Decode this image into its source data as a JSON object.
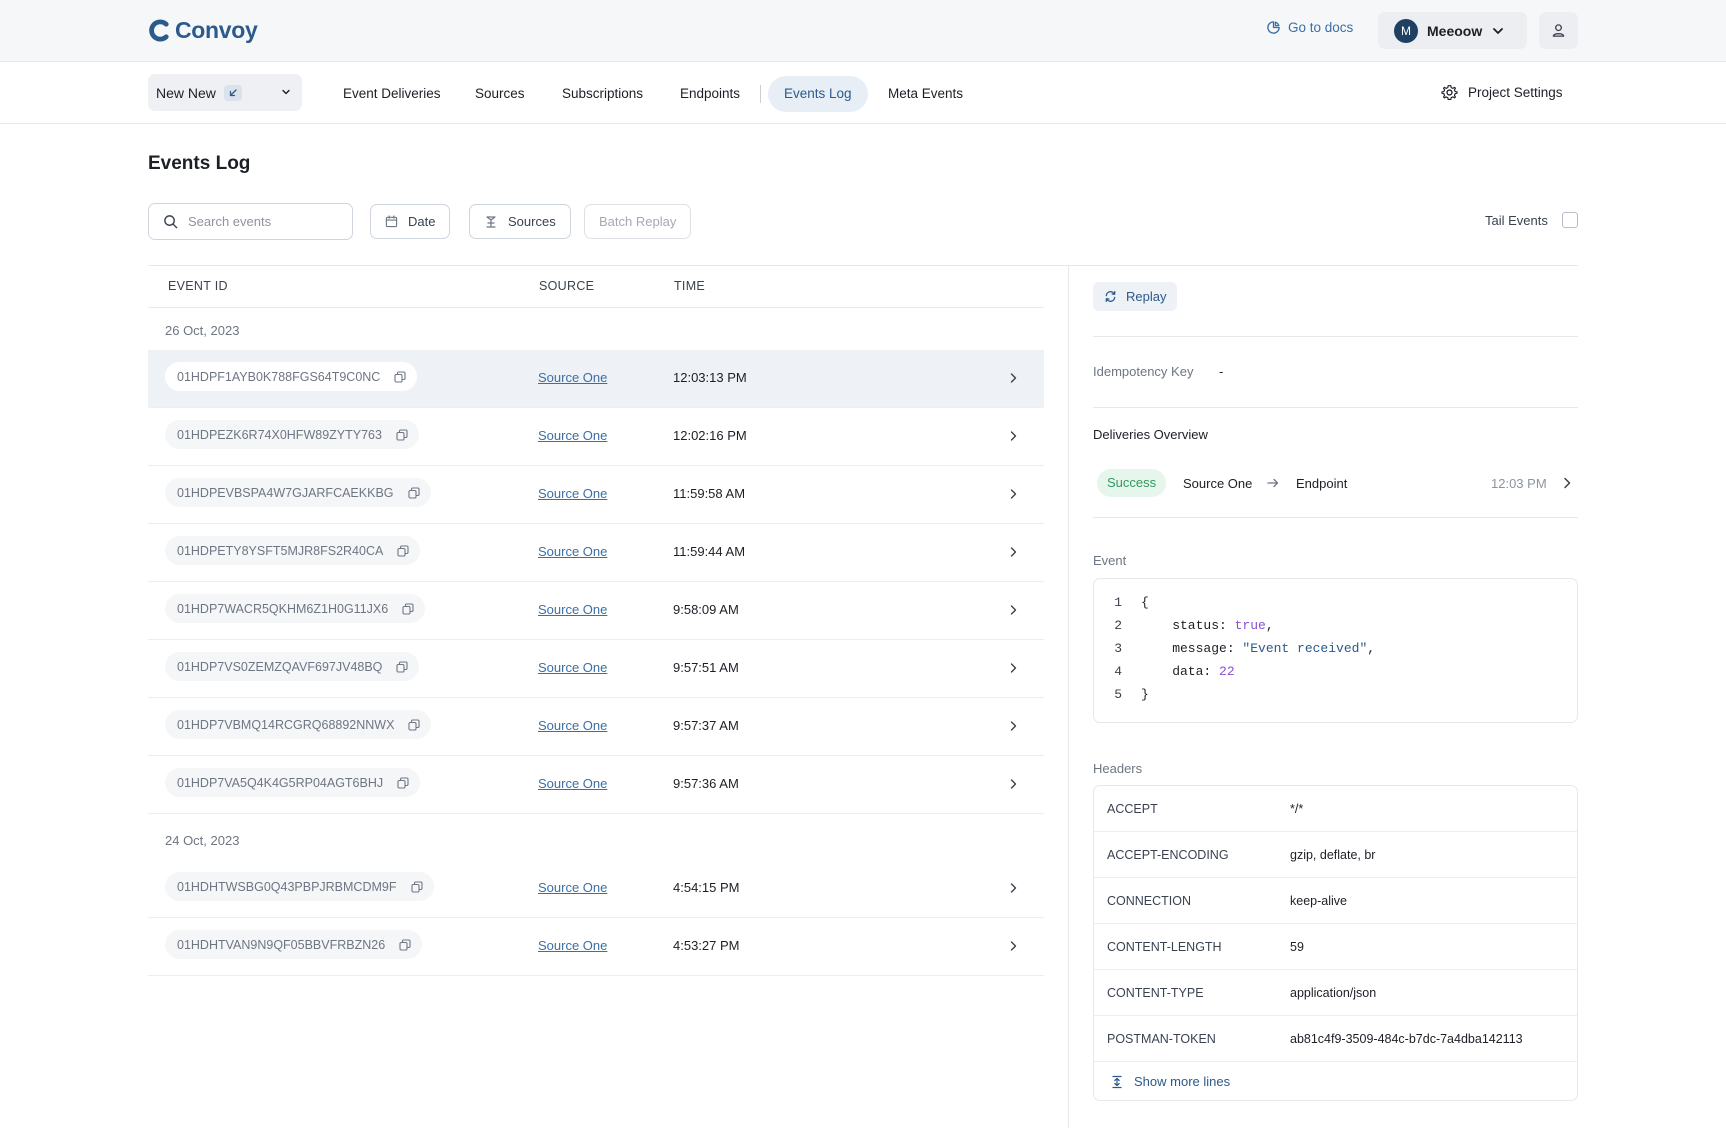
{
  "brand": {
    "name": "Convoy"
  },
  "topbar": {
    "docs_label": "Go to docs",
    "org_initial": "M",
    "org_name": "Meeoow"
  },
  "nav": {
    "project_name": "New New",
    "items": [
      {
        "label": "Event Deliveries"
      },
      {
        "label": "Sources"
      },
      {
        "label": "Subscriptions"
      },
      {
        "label": "Endpoints"
      },
      {
        "label": "Events Log"
      },
      {
        "label": "Meta Events"
      }
    ],
    "active_item": "Events Log",
    "settings_label": "Project Settings"
  },
  "page": {
    "title": "Events Log",
    "search_placeholder": "Search events",
    "date_label": "Date",
    "sources_label": "Sources",
    "batch_replay_label": "Batch Replay",
    "tail_label": "Tail Events",
    "tail_checked": false
  },
  "table": {
    "columns": [
      "EVENT ID",
      "SOURCE",
      "TIME"
    ],
    "groups": [
      {
        "date": "26 Oct, 2023",
        "rows": [
          {
            "id": "01HDPF1AYB0K788FGS64T9C0NC",
            "source": "Source One",
            "time": "12:03:13 PM",
            "selected": true
          },
          {
            "id": "01HDPEZK6R74X0HFW89ZYTY763",
            "source": "Source One",
            "time": "12:02:16 PM"
          },
          {
            "id": "01HDPEVBSPA4W7GJARFCAEKKBG",
            "source": "Source One",
            "time": "11:59:58 AM"
          },
          {
            "id": "01HDPETY8YSFT5MJR8FS2R40CA",
            "source": "Source One",
            "time": "11:59:44 AM"
          },
          {
            "id": "01HDP7WACR5QKHM6Z1H0G11JX6",
            "source": "Source One",
            "time": "9:58:09 AM"
          },
          {
            "id": "01HDP7VS0ZEMZQAVF697JV48BQ",
            "source": "Source One",
            "time": "9:57:51 AM"
          },
          {
            "id": "01HDP7VBMQ14RCGRQ68892NNWX",
            "source": "Source One",
            "time": "9:57:37 AM"
          },
          {
            "id": "01HDP7VA5Q4K4G5RP04AGT6BHJ",
            "source": "Source One",
            "time": "9:57:36 AM"
          }
        ]
      },
      {
        "date": "24 Oct, 2023",
        "rows": [
          {
            "id": "01HDHTWSBG0Q43PBPJRBMCDM9F",
            "source": "Source One",
            "time": "4:54:15 PM"
          },
          {
            "id": "01HDHTVAN9N9QF05BBVFRBZN26",
            "source": "Source One",
            "time": "4:53:27 PM"
          }
        ]
      }
    ]
  },
  "details": {
    "replay_label": "Replay",
    "idempotency_label": "Idempotency Key",
    "idempotency_value": "-",
    "deliveries_title": "Deliveries Overview",
    "delivery": {
      "status": "Success",
      "source": "Source One",
      "endpoint": "Endpoint",
      "time": "12:03 PM"
    },
    "event_label": "Event",
    "event_lines": [
      {
        "n": "1",
        "text": "{"
      },
      {
        "n": "2",
        "key": "    status: ",
        "value": "true",
        "value_type": "kw",
        "tail": ","
      },
      {
        "n": "3",
        "key": "    message: ",
        "value": "\"Event received\"",
        "value_type": "str",
        "tail": ","
      },
      {
        "n": "4",
        "key": "    data: ",
        "value": "22",
        "value_type": "kw",
        "tail": ""
      },
      {
        "n": "5",
        "text": "}"
      }
    ],
    "headers_label": "Headers",
    "headers": [
      {
        "key": "ACCEPT",
        "value": "*/*"
      },
      {
        "key": "ACCEPT-ENCODING",
        "value": "gzip, deflate, br"
      },
      {
        "key": "CONNECTION",
        "value": "keep-alive"
      },
      {
        "key": "CONTENT-LENGTH",
        "value": "59"
      },
      {
        "key": "CONTENT-TYPE",
        "value": "application/json"
      },
      {
        "key": "POSTMAN-TOKEN",
        "value": "ab81c4f9-3509-484c-b7dc-7a4dba142113"
      }
    ],
    "show_more_label": "Show more lines"
  },
  "colors": {
    "brand": "#2b5a8c",
    "link": "#3a6fa8",
    "success_bg": "#e6f6ec",
    "success_text": "#2f9a5d",
    "selected_row": "#eef1f5"
  },
  "icons": [
    "convoy-logo-icon",
    "docs-icon",
    "chevron-down-icon",
    "user-icon",
    "gear-icon",
    "search-icon",
    "calendar-icon",
    "sources-icon",
    "copy-icon",
    "chevron-right-icon",
    "replay-icon",
    "arrow-right-icon",
    "expand-icon"
  ]
}
